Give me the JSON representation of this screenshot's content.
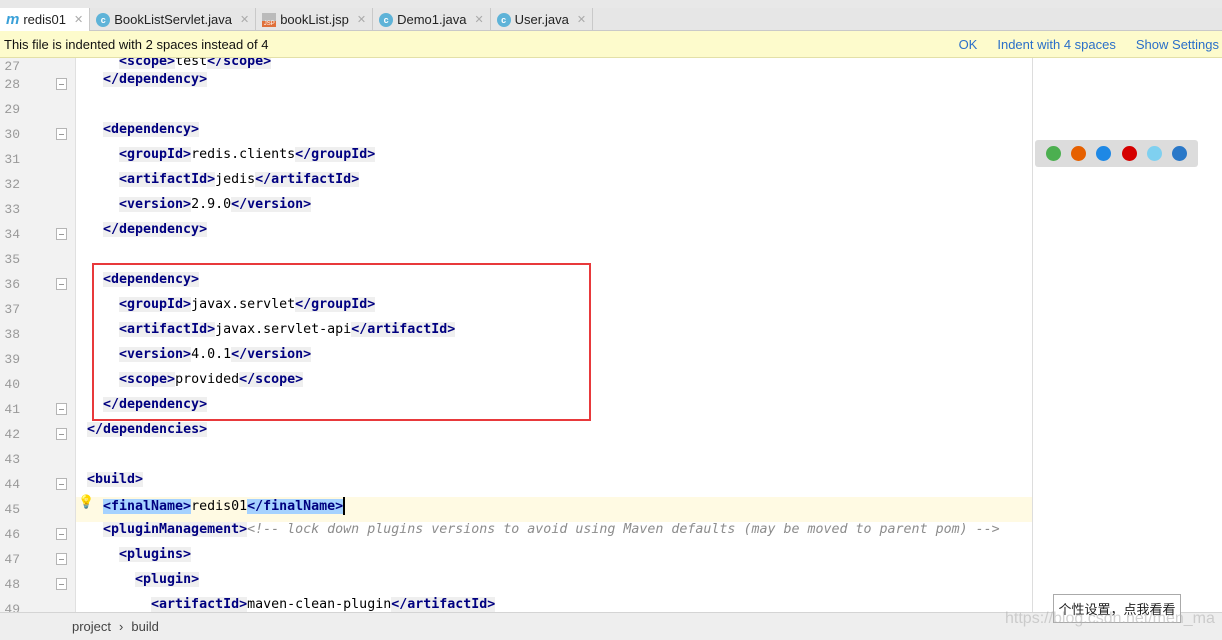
{
  "tabs": [
    {
      "label": "redis01",
      "icon": "maven-icon",
      "active": true
    },
    {
      "label": "BookListServlet.java",
      "icon": "class-icon"
    },
    {
      "label": "bookList.jsp",
      "icon": "jsp-icon"
    },
    {
      "label": "Demo1.java",
      "icon": "runnable-class-icon"
    },
    {
      "label": "User.java",
      "icon": "class-icon"
    }
  ],
  "notice": {
    "message": "This file is indented with 2 spaces instead of 4",
    "ok": "OK",
    "indent": "Indent with 4 spaces",
    "settings": "Show Settings"
  },
  "lines": [
    {
      "n": 27,
      "indent": 4,
      "tokens": [
        [
          "tag",
          "<scope>"
        ],
        [
          "text",
          "test"
        ],
        [
          "tag",
          "</scope>"
        ]
      ]
    },
    {
      "n": 28,
      "indent": 2,
      "fold": true,
      "tokens": [
        [
          "tag",
          "</dependency>"
        ]
      ]
    },
    {
      "n": 29,
      "indent": 0,
      "tokens": []
    },
    {
      "n": 30,
      "indent": 2,
      "fold": true,
      "tokens": [
        [
          "tag",
          "<dependency>"
        ]
      ]
    },
    {
      "n": 31,
      "indent": 4,
      "tokens": [
        [
          "tag",
          "<groupId>"
        ],
        [
          "text",
          "redis.clients"
        ],
        [
          "tag",
          "</groupId>"
        ]
      ]
    },
    {
      "n": 32,
      "indent": 4,
      "tokens": [
        [
          "tag",
          "<artifactId>"
        ],
        [
          "text",
          "jedis"
        ],
        [
          "tag",
          "</artifactId>"
        ]
      ]
    },
    {
      "n": 33,
      "indent": 4,
      "tokens": [
        [
          "tag",
          "<version>"
        ],
        [
          "text",
          "2.9.0"
        ],
        [
          "tag",
          "</version>"
        ]
      ]
    },
    {
      "n": 34,
      "indent": 2,
      "fold": true,
      "tokens": [
        [
          "tag",
          "</dependency>"
        ]
      ]
    },
    {
      "n": 35,
      "indent": 0,
      "tokens": []
    },
    {
      "n": 36,
      "indent": 2,
      "fold": true,
      "tokens": [
        [
          "tag",
          "<dependency>"
        ]
      ]
    },
    {
      "n": 37,
      "indent": 4,
      "tokens": [
        [
          "tag",
          "<groupId>"
        ],
        [
          "text",
          "javax.servlet"
        ],
        [
          "tag",
          "</groupId>"
        ]
      ]
    },
    {
      "n": 38,
      "indent": 4,
      "tokens": [
        [
          "tag",
          "<artifactId>"
        ],
        [
          "text",
          "javax.servlet-api"
        ],
        [
          "tag",
          "</artifactId>"
        ]
      ]
    },
    {
      "n": 39,
      "indent": 4,
      "tokens": [
        [
          "tag",
          "<version>"
        ],
        [
          "text",
          "4.0.1"
        ],
        [
          "tag",
          "</version>"
        ]
      ]
    },
    {
      "n": 40,
      "indent": 4,
      "tokens": [
        [
          "tag",
          "<scope>"
        ],
        [
          "text",
          "provided"
        ],
        [
          "tag",
          "</scope>"
        ]
      ]
    },
    {
      "n": 41,
      "indent": 2,
      "fold": true,
      "tokens": [
        [
          "tag",
          "</dependency>"
        ]
      ]
    },
    {
      "n": 42,
      "indent": 0,
      "fold": true,
      "tokens": [
        [
          "tag",
          "</dependencies>"
        ]
      ]
    },
    {
      "n": 43,
      "indent": 0,
      "tokens": []
    },
    {
      "n": 44,
      "indent": 0,
      "fold": true,
      "tokens": [
        [
          "tag",
          "<build>"
        ]
      ]
    },
    {
      "n": 45,
      "indent": 2,
      "current": true,
      "tokens": [
        [
          "seltag",
          "<finalName>"
        ],
        [
          "text",
          "redis01"
        ],
        [
          "seltag",
          "</finalName>"
        ],
        [
          "caret",
          ""
        ]
      ]
    },
    {
      "n": 46,
      "indent": 2,
      "fold": true,
      "tokens": [
        [
          "tag",
          "<pluginManagement>"
        ],
        [
          "comment",
          "<!-- lock down plugins versions to avoid using Maven defaults (may be moved to parent pom) -->"
        ]
      ]
    },
    {
      "n": 47,
      "indent": 4,
      "fold": true,
      "tokens": [
        [
          "tag",
          "<plugins>"
        ]
      ]
    },
    {
      "n": 48,
      "indent": 6,
      "fold": true,
      "tokens": [
        [
          "tag",
          "<plugin>"
        ]
      ]
    },
    {
      "n": 49,
      "indent": 8,
      "tokens": [
        [
          "tag",
          "<artifactId>"
        ],
        [
          "text",
          "maven-clean-plugin"
        ],
        [
          "tag",
          "</artifactId>"
        ]
      ]
    }
  ],
  "browsers": [
    {
      "name": "chrome-icon",
      "color": "#4caf50"
    },
    {
      "name": "firefox-icon",
      "color": "#e66000"
    },
    {
      "name": "safari-icon",
      "color": "#1e88e5"
    },
    {
      "name": "opera-icon",
      "color": "#d50000"
    },
    {
      "name": "ie-icon",
      "color": "#7fd0f0"
    },
    {
      "name": "edge-icon",
      "color": "#2a78c8"
    }
  ],
  "breadcrumb": [
    "project",
    "build"
  ],
  "breadcrumb_sep": "›",
  "tooltip": "个性设置，点我看看",
  "watermark": "https://blog.csdn.net/men_ma"
}
